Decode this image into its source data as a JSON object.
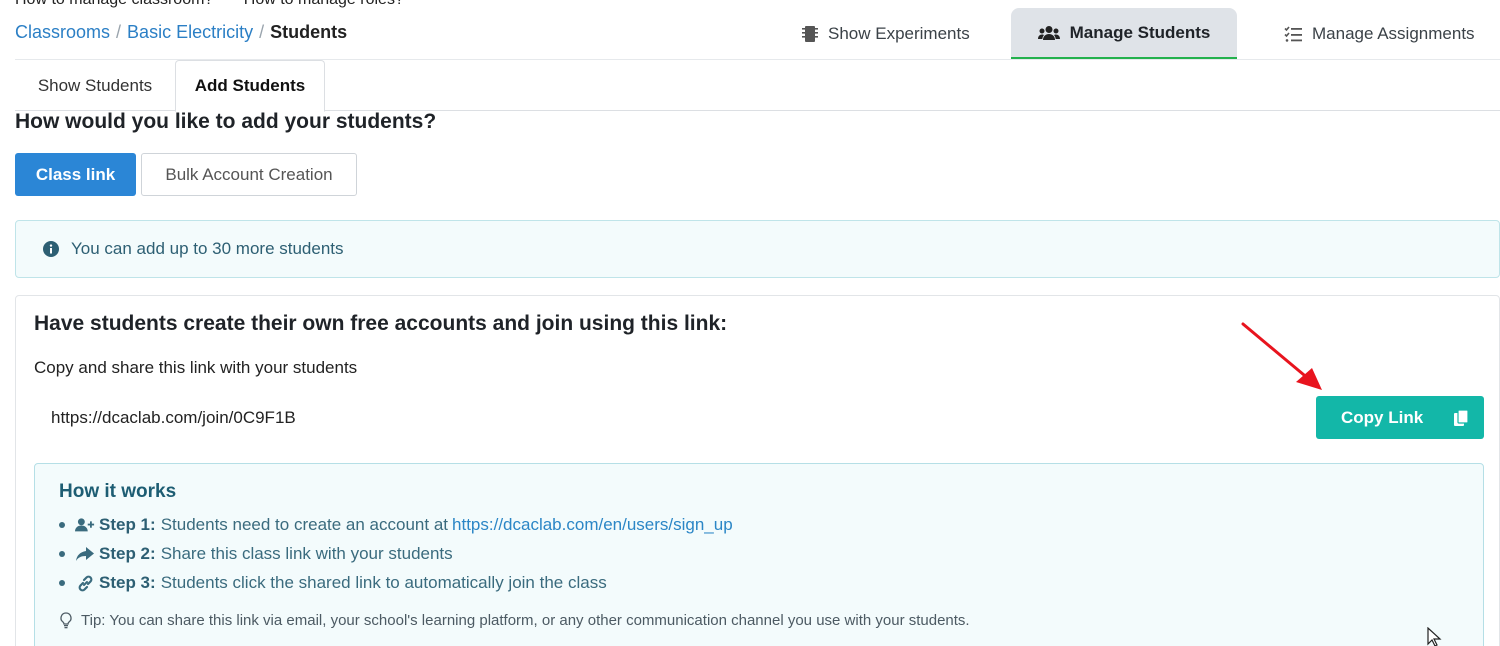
{
  "top_links": [
    "How to manage classroom?",
    "How to manage roles?"
  ],
  "breadcrumb": {
    "items": [
      "Classrooms",
      "Basic Electricity"
    ],
    "separator": "/",
    "current": "Students"
  },
  "nav": {
    "experiments": "Show Experiments",
    "students": "Manage Students",
    "assignments": "Manage Assignments"
  },
  "tabs": {
    "show": "Show Students",
    "add": "Add Students"
  },
  "question": "How would you like to add your students?",
  "modes": {
    "class_link": "Class link",
    "bulk": "Bulk Account Creation"
  },
  "info": "You can add up to 30 more students",
  "card": {
    "title": "Have students create their own free accounts and join using this link:",
    "subtitle": "Copy and share this link with your students",
    "url": "https://dcaclab.com/join/0C9F1B",
    "copy_label": "Copy Link"
  },
  "how": {
    "title": "How it works",
    "steps": [
      {
        "label": "Step 1:",
        "text": "Students need to create an account at",
        "link": "https://dcaclab.com/en/users/sign_up",
        "icon": "user-plus-icon"
      },
      {
        "label": "Step 2:",
        "text": "Share this class link with your students",
        "icon": "share-icon"
      },
      {
        "label": "Step 3:",
        "text": "Students click the shared link to automatically join the class",
        "icon": "link-icon"
      }
    ],
    "tip": "Tip: You can share this link via email, your school's learning platform, or any other communication channel you use with your students."
  },
  "colors": {
    "primary": "#2b86d6",
    "teal": "#13b7a8",
    "active_underline": "#23b14d",
    "annotation_arrow": "#e8141e"
  }
}
